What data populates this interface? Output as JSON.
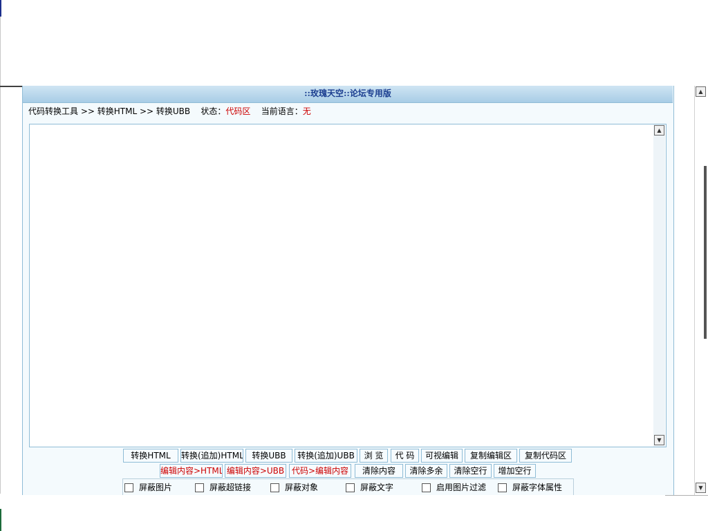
{
  "title": "::玫瑰天空::论坛专用版",
  "status": {
    "breadcrumb": "代码转换工具 >> 转换HTML >> 转换UBB",
    "state_label": "状态：",
    "state_value": "代码区",
    "lang_label": "当前语言：",
    "lang_value": "无"
  },
  "editor": {
    "content": ""
  },
  "buttons_row1": [
    "转换HTML",
    "转换(追加)HTML",
    "转换UBB",
    "转换(追加)UBB",
    "浏 览",
    "代 码",
    "可视编辑",
    "复制编辑区",
    "复制代码区"
  ],
  "buttons_row2": [
    "编辑内容>HTML",
    "编辑内容>UBB",
    "代码>编辑内容",
    "清除内容",
    "清除多余",
    "清除空行",
    "增加空行"
  ],
  "options": [
    "屏蔽图片",
    "屏蔽超链接",
    "屏蔽对象",
    "屏蔽文字",
    "启用图片过滤",
    "屏蔽字体属性"
  ],
  "colors": {
    "title_bg": "#a8cde6",
    "title_text": "#1a3d8f",
    "accent_red": "#cc0000",
    "border": "#8fbcd6"
  },
  "icons": {
    "scroll_up": "▲",
    "scroll_down": "▼"
  }
}
